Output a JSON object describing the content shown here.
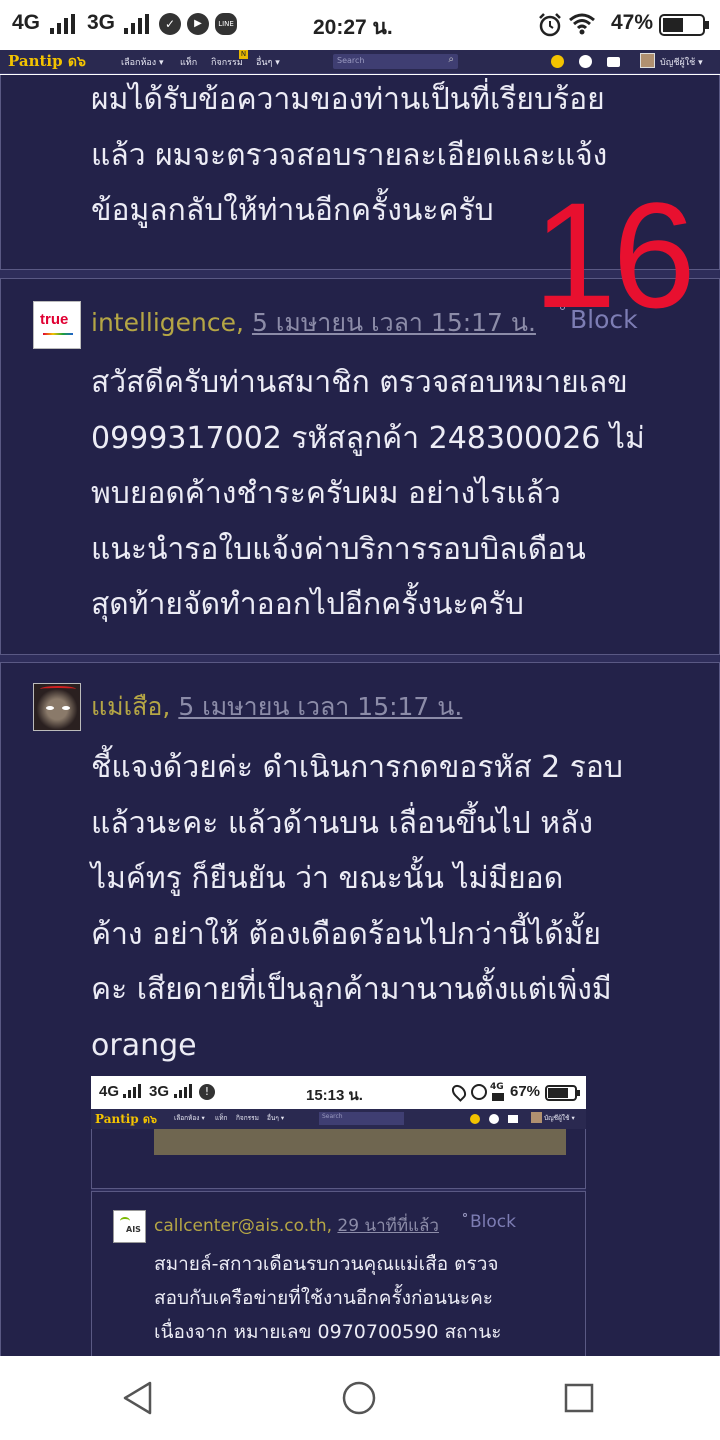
{
  "status_bar": {
    "network_1": "4G",
    "network_2": "3G",
    "time": "20:27 น.",
    "battery": "47%"
  },
  "pantip_nav": {
    "logo": "Pantip",
    "logo_mark": "ด๖",
    "menu_rooms": "เลือกห้อง ▾",
    "menu_tags": "แท็ก",
    "menu_activities": "กิจกรรม",
    "activity_badge": "N",
    "menu_more": "อื่นๆ ▾",
    "search_placeholder": "Search",
    "account": "บัญชีผู้ใช้ ▾"
  },
  "overlay_number": "16",
  "posts": [
    {
      "body": [
        "ผมได้รับข้อความของท่านเป็นที่เรียบร้อย",
        "แล้ว ผมจะตรวจสอบรายละเอียดและแจ้ง",
        "ข้อมูลกลับให้ท่านอีกครั้งนะครับ"
      ]
    },
    {
      "username": "intelligence",
      "timestamp": "5 เมษายน เวลา 15:17 น.",
      "block": "Block",
      "avatar_text": "true",
      "body": [
        "สวัสดีครับท่านสมาชิก ตรวจสอบหมายเลข",
        "0999317002 รหัสลูกค้า 248300026 ไม่",
        "พบยอดค้างชำระครับผม อย่างไรแล้ว",
        "แนะนำรอใบแจ้งค่าบริการรอบบิลเดือน",
        "สุดท้ายจัดทำออกไปอีกครั้งนะครับ"
      ]
    },
    {
      "username": "แม่เสือ",
      "timestamp": "5 เมษายน เวลา 15:17 น.",
      "body": [
        "ชี้แจงด้วยค่ะ  ดำเนินการกดขอรหัส 2 รอบ",
        "แล้วนะคะ  แล้วด้านบน เลื่อนขึ้นไป หลัง",
        "ไมค์ทรู ก็ยืนยัน ว่า ขณะนั้น ไม่มียอด",
        "ค้าง  อย่าให้ ต้องเดือดร้อนไปกว่านี้ได้มั้ย",
        "คะ  เสียดายที่เป็นลูกค้ามานานตั้งแต่เพิ่งมี",
        "orange"
      ]
    }
  ],
  "embedded_screenshot": {
    "status": {
      "network_1": "4G",
      "network_2": "3G",
      "time": "15:13 น.",
      "network_3": "4G",
      "battery": "67%"
    },
    "nav": {
      "logo": "Pantip",
      "logo_mark": "ด๖",
      "menu_rooms": "เลือกห้อง ▾",
      "menu_tags": "แท็ก",
      "menu_activities": "กิจกรรม",
      "menu_more": "อื่นๆ ▾",
      "search_placeholder": "Search",
      "account": "บัญชีผู้ใช้ ▾"
    },
    "reply": {
      "username": "callcenter@ais.co.th",
      "timestamp": "29 นาทีที่แล้ว",
      "block": "Block",
      "avatar_text": "AIS",
      "body": [
        "สมายล์-สกาวเดือนรบกวนคุณแม่เสือ ตรวจ",
        "สอบกับเครือข่ายที่ใช้งานอีกครั้งก่อนนะคะ",
        "เนื่องจาก หมายเลข 0970700590  สถานะ"
      ]
    }
  },
  "colors": {
    "background": "#2e2d5a",
    "card": "#232249",
    "username": "#b5a645",
    "overlay": "#e8102f",
    "logo": "#f3c300"
  },
  "icons": [
    "checkmark-icon",
    "youtube-icon",
    "line-icon",
    "alarm-icon",
    "wifi-icon",
    "battery-icon",
    "back-icon",
    "home-icon",
    "recents-icon"
  ]
}
